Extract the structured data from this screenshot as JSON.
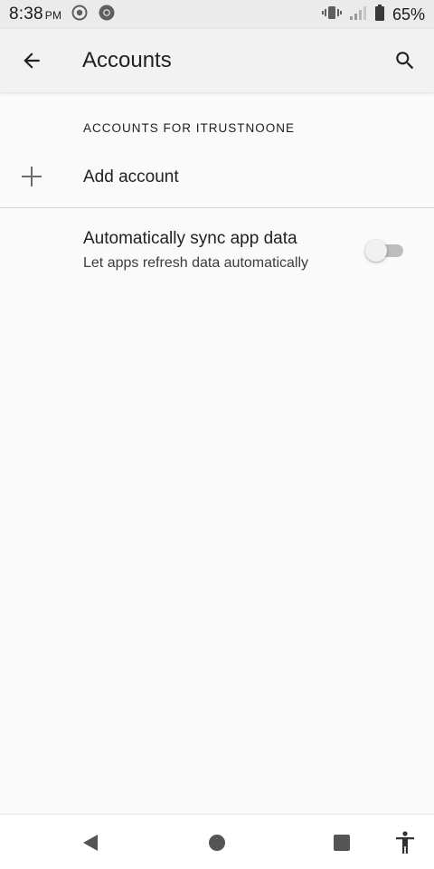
{
  "status_bar": {
    "time": "8:38",
    "ampm": "PM",
    "battery_percent": "65%",
    "icons_left": [
      "screen-record-icon",
      "chrome-icon"
    ],
    "icons_right": [
      "vibrate-icon",
      "signal-icon",
      "battery-icon"
    ]
  },
  "app_bar": {
    "title": "Accounts",
    "back_icon": "arrow-back-icon",
    "search_icon": "search-icon"
  },
  "section": {
    "header": "ACCOUNTS FOR ITRUSTNOONE"
  },
  "add_account": {
    "label": "Add account",
    "icon": "plus-icon"
  },
  "sync": {
    "title": "Automatically sync app data",
    "subtitle": "Let apps refresh data automatically",
    "enabled": false
  },
  "nav_bar": {
    "buttons": [
      "back-triangle-icon",
      "home-circle-icon",
      "recents-square-icon",
      "accessibility-icon"
    ]
  },
  "colors": {
    "status_bar_bg": "#ebebeb",
    "app_bar_bg": "#f2f2f2",
    "page_bg": "#fafafa",
    "text_primary": "#202124",
    "toggle_track": "#bdbdbd"
  }
}
